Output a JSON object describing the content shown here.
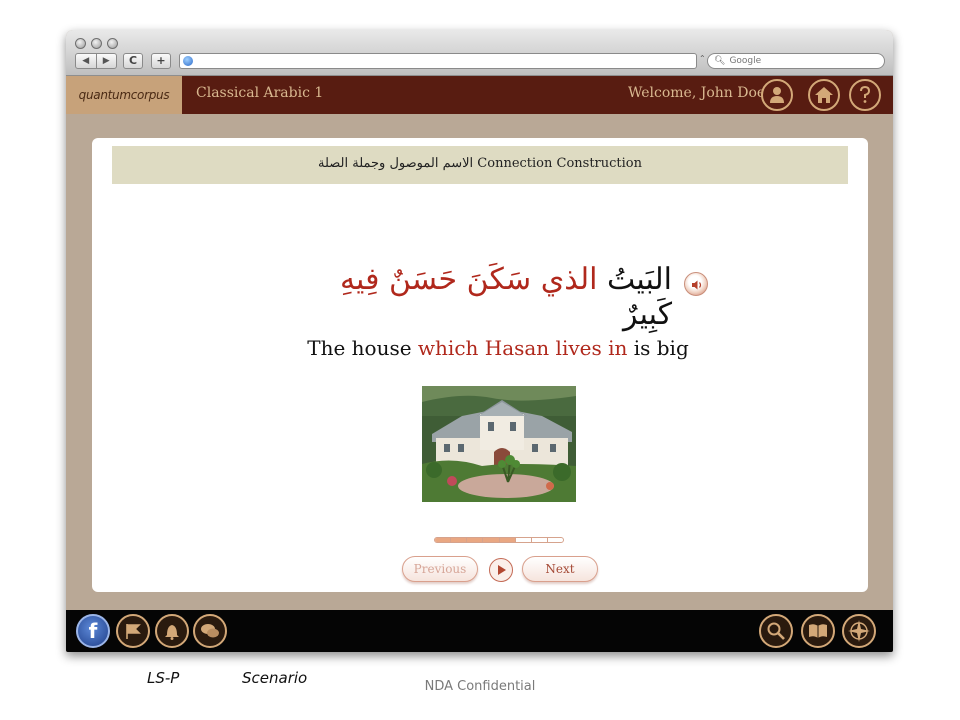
{
  "browser": {
    "nav_back": "◀",
    "nav_forward": "▶",
    "reload": "C",
    "new_tab": "+",
    "url": "",
    "search_placeholder": "Google"
  },
  "app": {
    "logo_text": "quantumcorpus",
    "course_title": "Classical Arabic 1",
    "welcome_text": "Welcome, John Doe",
    "header_icons": [
      "user-icon",
      "home-icon",
      "help-icon"
    ]
  },
  "lesson": {
    "section_title": "الاسم الموصول وجملة الصلة Connection Construction",
    "arabic_pre": "البَيتُ ",
    "arabic_highlight": "الذي سَكَنَ حَسَنٌ فِيهِ",
    "arabic_post": " كَبِيرٌ",
    "english_pre": "The house ",
    "english_highlight": "which Hasan lives in",
    "english_post": " is big",
    "progress_completed": 5,
    "progress_total": 8,
    "prev_label": "Previous",
    "next_label": "Next"
  },
  "bottom_icons": [
    "facebook-icon",
    "flag-icon",
    "bell-icon",
    "chat-icon",
    "search-icon",
    "book-icon",
    "compass-icon"
  ],
  "facebook_glyph": "f",
  "footer": {
    "left_label": "LS-P",
    "scenario_label": "Scenario",
    "confidential": "NDA Confidential"
  },
  "colors": {
    "header_bg": "#581c11",
    "logo_bg": "#c7a27a",
    "accent_gold": "#d3a878",
    "highlight_red": "#b0281c",
    "title_bar_bg": "#dedbc2",
    "frame_bg": "#b9a896"
  }
}
